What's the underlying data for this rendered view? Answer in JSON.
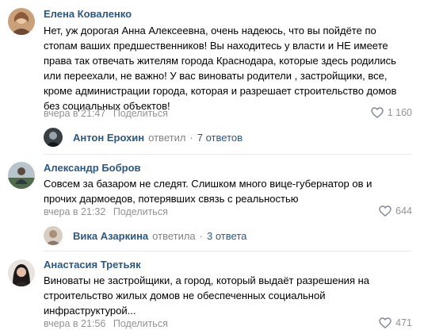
{
  "comments": [
    {
      "author": "Елена Коваленко",
      "lines": [
        "Нет, уж дорогая Анна Алексеевна, очень надеюсь, что вы пойдёте по",
        "стопам ваших предшественников! Вы находитесь у власти и НЕ имеете",
        "права так отвечать жителям города Краснодара, которые здесь родились",
        "или переехали, не важно! У вас виноваты родители , застройщики, все,",
        "кроме администрации города, которая и разрешает строительство домов",
        "без социальных объектов!"
      ],
      "time": "вчера в 21:47",
      "reply_label": "Поделиться",
      "likes": "1 160",
      "thread": {
        "name": "Антон Ерохин",
        "verb": "ответил",
        "dot": "·",
        "count": "7 ответов"
      }
    },
    {
      "author": "Александр Бобров",
      "lines": [
        "Совсем за базаром не следят. Слишком много вице-губернатор ов и",
        "прочих дармоедов, потерявших связь с реальностью"
      ],
      "time": "вчера в 21:32",
      "reply_label": "Поделиться",
      "likes": "644",
      "thread": {
        "name": "Вика Азаркина",
        "verb": "ответила",
        "dot": "·",
        "count": "3 ответа"
      }
    },
    {
      "author": "Анастасия Третьяк",
      "lines": [
        "Виноваты не застройщики, а город, который выдаёт разрешения на",
        "строительство жилых домов не обеспеченных социальной",
        "инфраструктурой..."
      ],
      "time": "вчера в 21:56",
      "reply_label": "Поделиться",
      "likes": "471"
    }
  ],
  "colors": {
    "author": "#2a5885",
    "meta": "#939393",
    "separator": "#e7e8ec"
  },
  "icons": {
    "like": "heart-icon"
  }
}
